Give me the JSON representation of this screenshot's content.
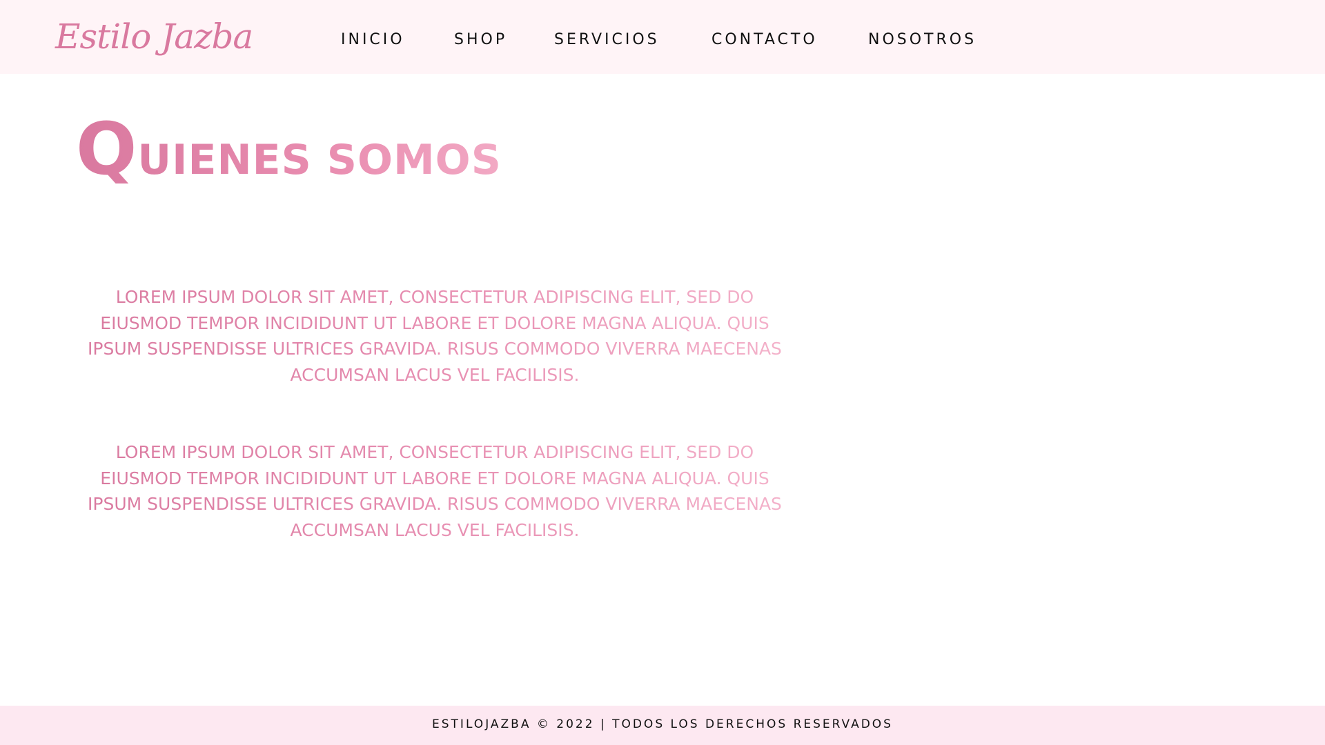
{
  "brand": {
    "logo_text": "Estilo Jazba",
    "accent_color": "#d9799f",
    "header_bg": "#fff4f7",
    "footer_bg": "#fde8f1"
  },
  "nav": {
    "items": [
      {
        "label": "INICIO"
      },
      {
        "label": "SHOP"
      },
      {
        "label": "SERVICIOS"
      },
      {
        "label": "CONTACTO"
      },
      {
        "label": "NOSOTROS"
      }
    ]
  },
  "main": {
    "title_initial": "Q",
    "title_rest": "UIENES SOMOS",
    "paragraphs": [
      "Lorem ipsum dolor sit amet, consectetur adipiscing elit, sed do eiusmod tempor incididunt ut labore et dolore magna aliqua. Quis ipsum suspendisse ultrices gravida. Risus commodo viverra maecenas accumsan lacus vel facilisis.",
      "Lorem ipsum dolor sit amet, consectetur adipiscing elit, sed do eiusmod tempor incididunt ut labore et dolore magna aliqua. Quis ipsum suspendisse ultrices gravida. Risus commodo viverra maecenas accumsan lacus vel facilisis."
    ]
  },
  "footer": {
    "text": "ESTILOJAZBA © 2022 | TODOS LOS DERECHOS RESERVADOS"
  }
}
